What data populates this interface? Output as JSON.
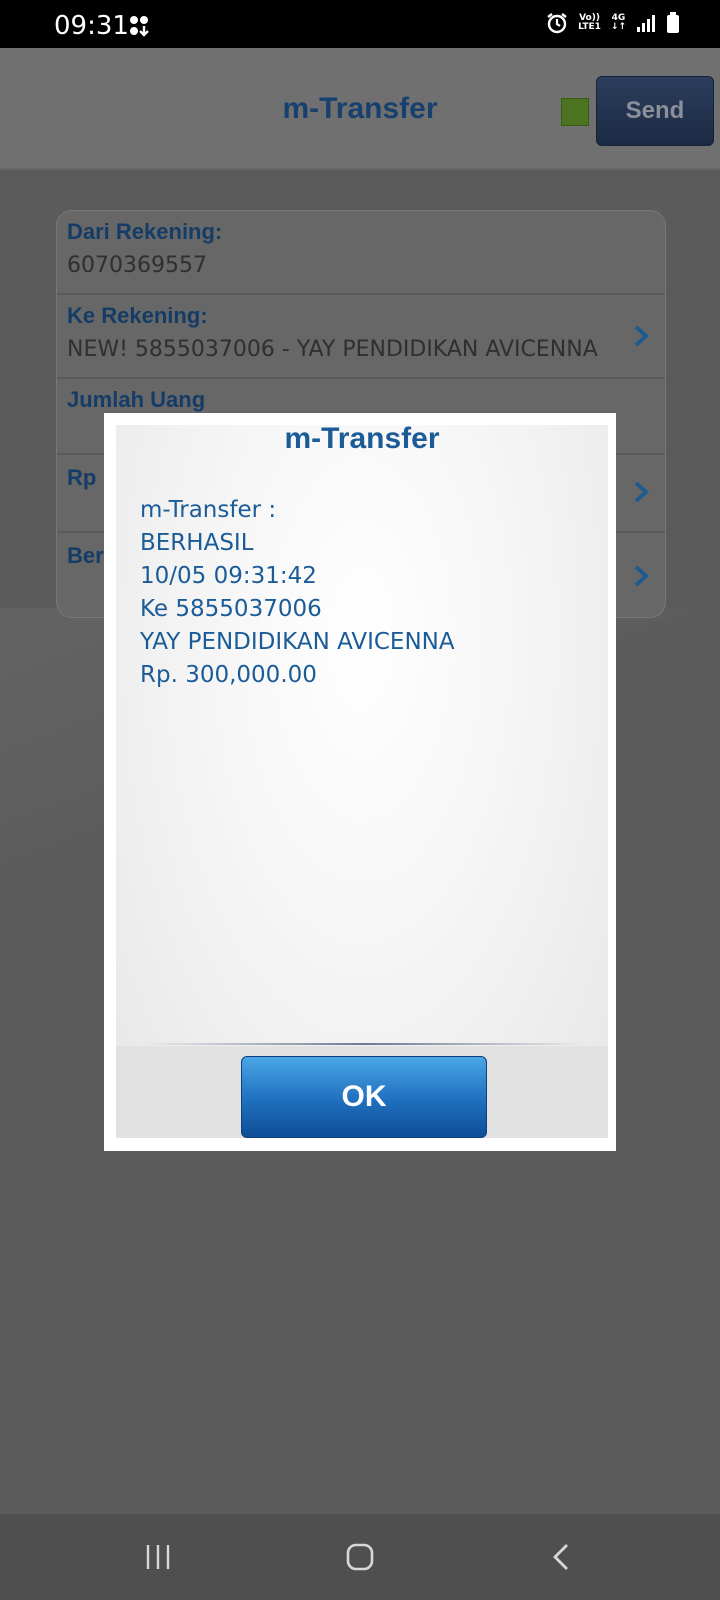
{
  "status_bar": {
    "time": "09:31",
    "volte_label": "Vo))",
    "lte_label": "LTE1",
    "network_label": "4G"
  },
  "header": {
    "title": "m-Transfer",
    "send_label": "Send",
    "indicator_color": "#4b7320"
  },
  "form": {
    "rows": [
      {
        "label": "Dari Rekening:",
        "value": "6070369557"
      },
      {
        "label": "Ke Rekening:",
        "value": "NEW! 5855037006 - YAY PENDIDIKAN AVICENNA"
      },
      {
        "label": "Jumlah Uang",
        "value": ""
      },
      {
        "label": "Rp",
        "value": ""
      },
      {
        "label": "Ber",
        "value": ""
      }
    ]
  },
  "dialog": {
    "title": "m-Transfer",
    "message_lines": [
      "m-Transfer :",
      "BERHASIL",
      "10/05 09:31:42",
      "Ke 5855037006",
      "YAY PENDIDIKAN AVICENNA",
      "Rp. 300,000.00"
    ],
    "ok_label": "OK"
  },
  "colors": {
    "accent_blue": "#1b5c98",
    "ok_button": "#1f6fbd"
  }
}
